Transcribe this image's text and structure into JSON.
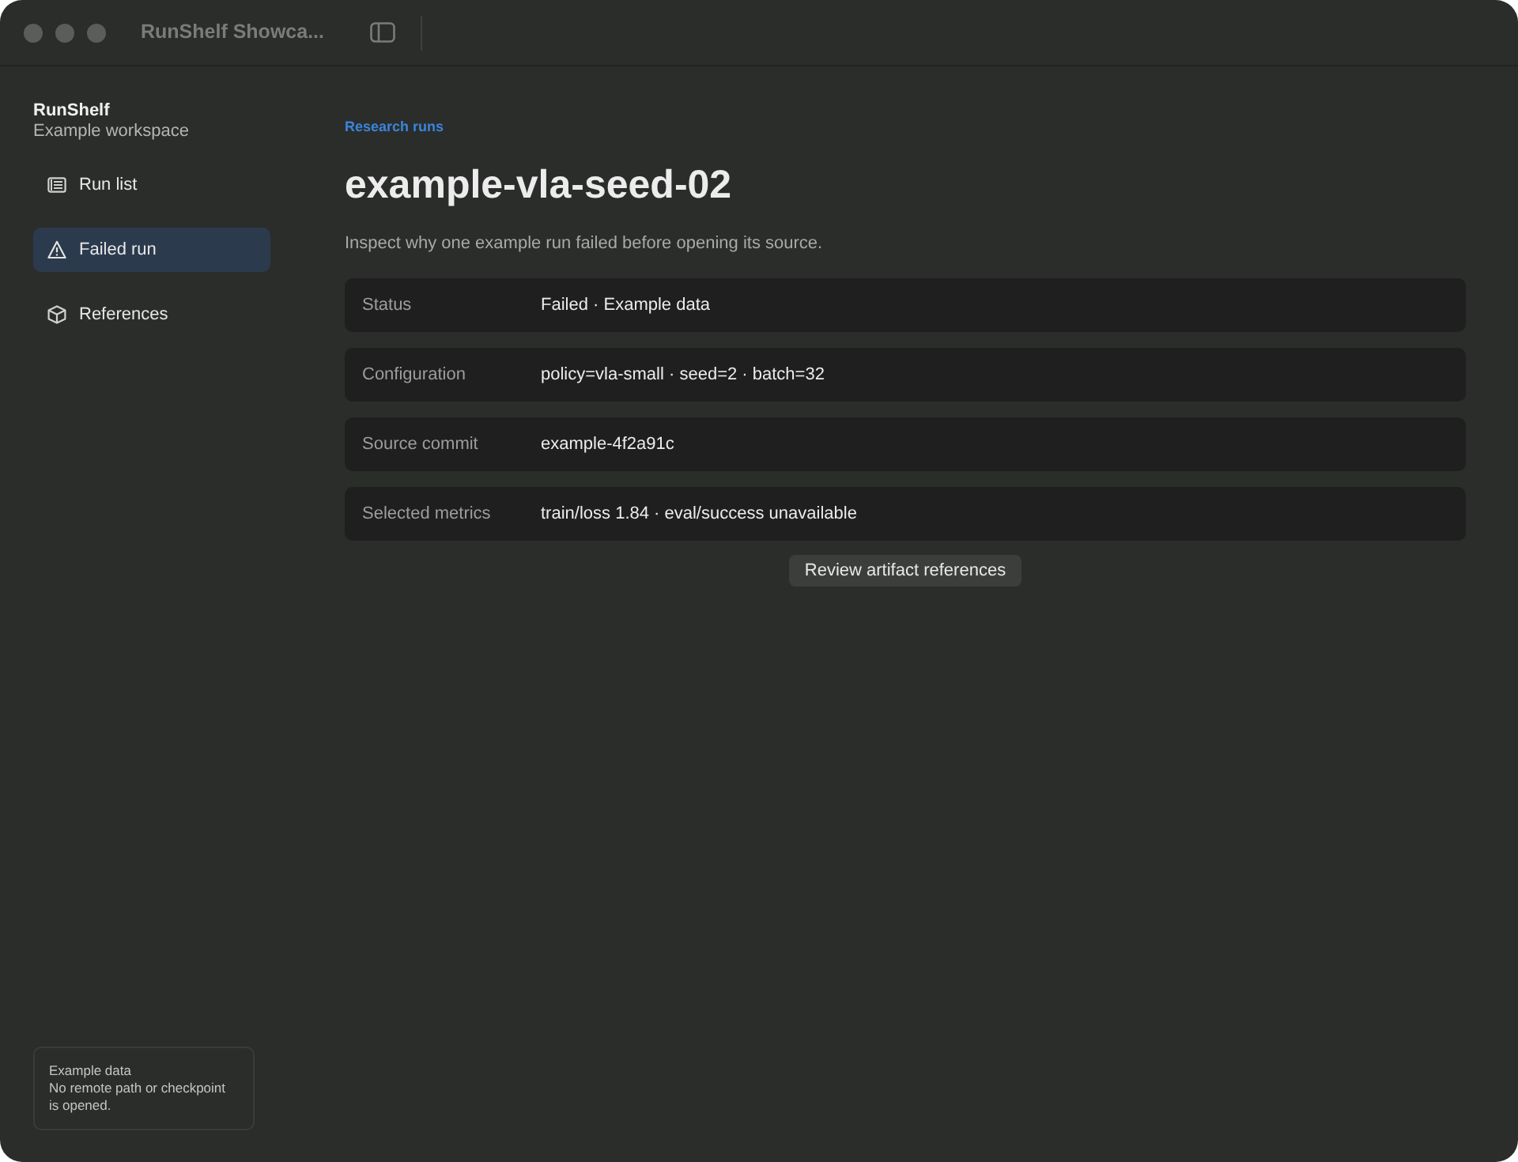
{
  "window": {
    "title": "RunShelf Showca..."
  },
  "sidebar": {
    "app_name": "RunShelf",
    "workspace": "Example workspace",
    "items": [
      {
        "label": "Run list",
        "kind": "list",
        "selected": false
      },
      {
        "label": "Failed run",
        "kind": "warning",
        "selected": true
      },
      {
        "label": "References",
        "kind": "box",
        "selected": false
      }
    ],
    "footer": {
      "title": "Example data",
      "note": "No remote path or checkpoint is opened."
    }
  },
  "breadcrumb": "Research runs",
  "heading": "example-vla-seed-02",
  "subtitle": "Inspect why one example run failed before opening its source.",
  "details": [
    {
      "label": "Status",
      "value": "Failed · Example data"
    },
    {
      "label": "Configuration",
      "value": "policy=vla-small · seed=2 · batch=32"
    },
    {
      "label": "Source commit",
      "value": "example-4f2a91c"
    },
    {
      "label": "Selected metrics",
      "value": "train/loss 1.84 · eval/success unavailable"
    }
  ],
  "action_button": "Review artifact references"
}
